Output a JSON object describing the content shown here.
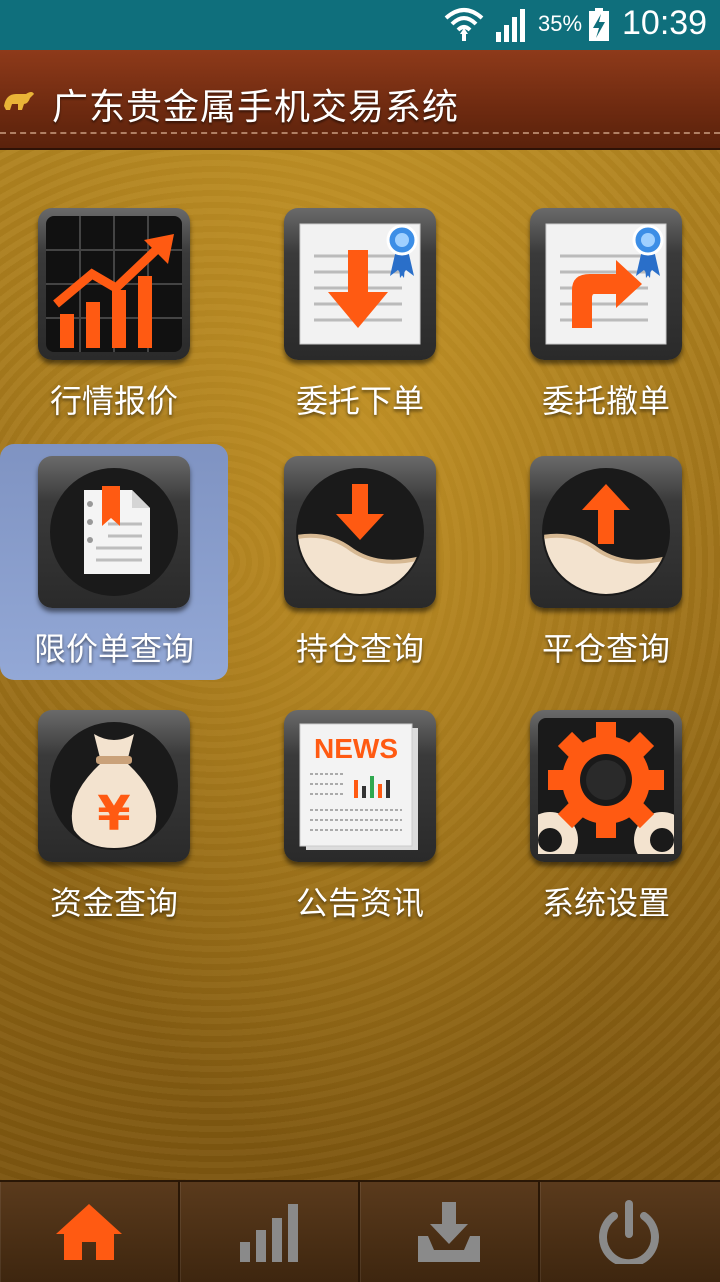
{
  "status_bar": {
    "battery_percent": "35%",
    "time": "10:39",
    "icons": [
      "wifi-icon",
      "signal-icon",
      "battery-charging-icon"
    ]
  },
  "header": {
    "title": "广东贵金属手机交易系统",
    "logo_icon": "bull-logo-icon"
  },
  "menu": {
    "items": [
      {
        "label": "行情报价",
        "icon": "market-chart-icon",
        "selected": false
      },
      {
        "label": "委托下单",
        "icon": "order-place-icon",
        "selected": false
      },
      {
        "label": "委托撤单",
        "icon": "order-cancel-icon",
        "selected": false
      },
      {
        "label": "限价单查询",
        "icon": "limit-order-query-icon",
        "selected": true
      },
      {
        "label": "持仓查询",
        "icon": "position-query-icon",
        "selected": false
      },
      {
        "label": "平仓查询",
        "icon": "close-position-query-icon",
        "selected": false
      },
      {
        "label": "资金查询",
        "icon": "money-bag-icon",
        "selected": false
      },
      {
        "label": "公告资讯",
        "icon": "news-icon",
        "selected": false
      },
      {
        "label": "系统设置",
        "icon": "settings-gear-icon",
        "selected": false
      }
    ],
    "news_icon_text": "NEWS",
    "money_symbol": "¥"
  },
  "bottom_nav": {
    "items": [
      {
        "icon": "home-icon",
        "active": true
      },
      {
        "icon": "bar-chart-icon",
        "active": false
      },
      {
        "icon": "download-icon",
        "active": false
      },
      {
        "icon": "power-icon",
        "active": false
      }
    ]
  },
  "colors": {
    "status_bar": "#0f6f7c",
    "header": "#7a2e12",
    "accent_orange": "#ff5a12",
    "selected_tile": "#8aa0d0"
  }
}
